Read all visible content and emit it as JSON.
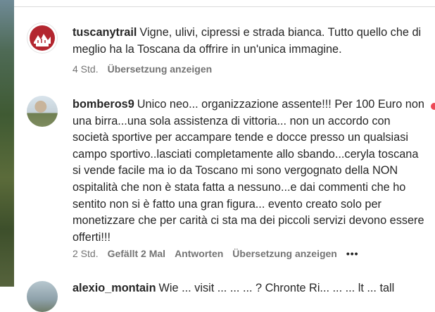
{
  "comments": [
    {
      "username": "tuscanytrail",
      "text": "Vigne, ulivi, cipressi e strada bianca. Tutto quello che di meglio ha la Toscana da offrire in un'unica immagine.",
      "time": "4 Std.",
      "translate": "Übersetzung anzeigen"
    },
    {
      "username": "bomberos9",
      "text": "Unico neo... organizzazione assente!!! Per 100 Euro non una birra...una sola assistenza di vittoria... non un accordo con società sportive per accampare tende e docce presso un qualsiasi campo sportivo..lasciati completamente allo sbando...ceryla toscana si vende facile ma io da Toscano mi sono vergognato della NON ospitalità che non è stata fatta a nessuno...e dai commenti che ho sentito non si è fatto una gran figura... evento creato solo per monetizzare che per carità ci sta ma dei piccoli servizi devono essere offerti!!!",
      "time": "2 Std.",
      "likes": "Gefällt 2 Mal",
      "reply": "Antworten",
      "translate": "Übersetzung anzeigen",
      "more": "•••"
    },
    {
      "username": "alexio_montain",
      "text": "Wie ... visit ... ... ... ? Chronte Ri... ... ... lt ... tall"
    }
  ],
  "icons": {
    "like": "heart-icon",
    "more": "more-options-icon"
  },
  "colors": {
    "text": "#262626",
    "meta": "#737373",
    "like": "#ed4956",
    "avatar_brand": "#b3262f"
  }
}
